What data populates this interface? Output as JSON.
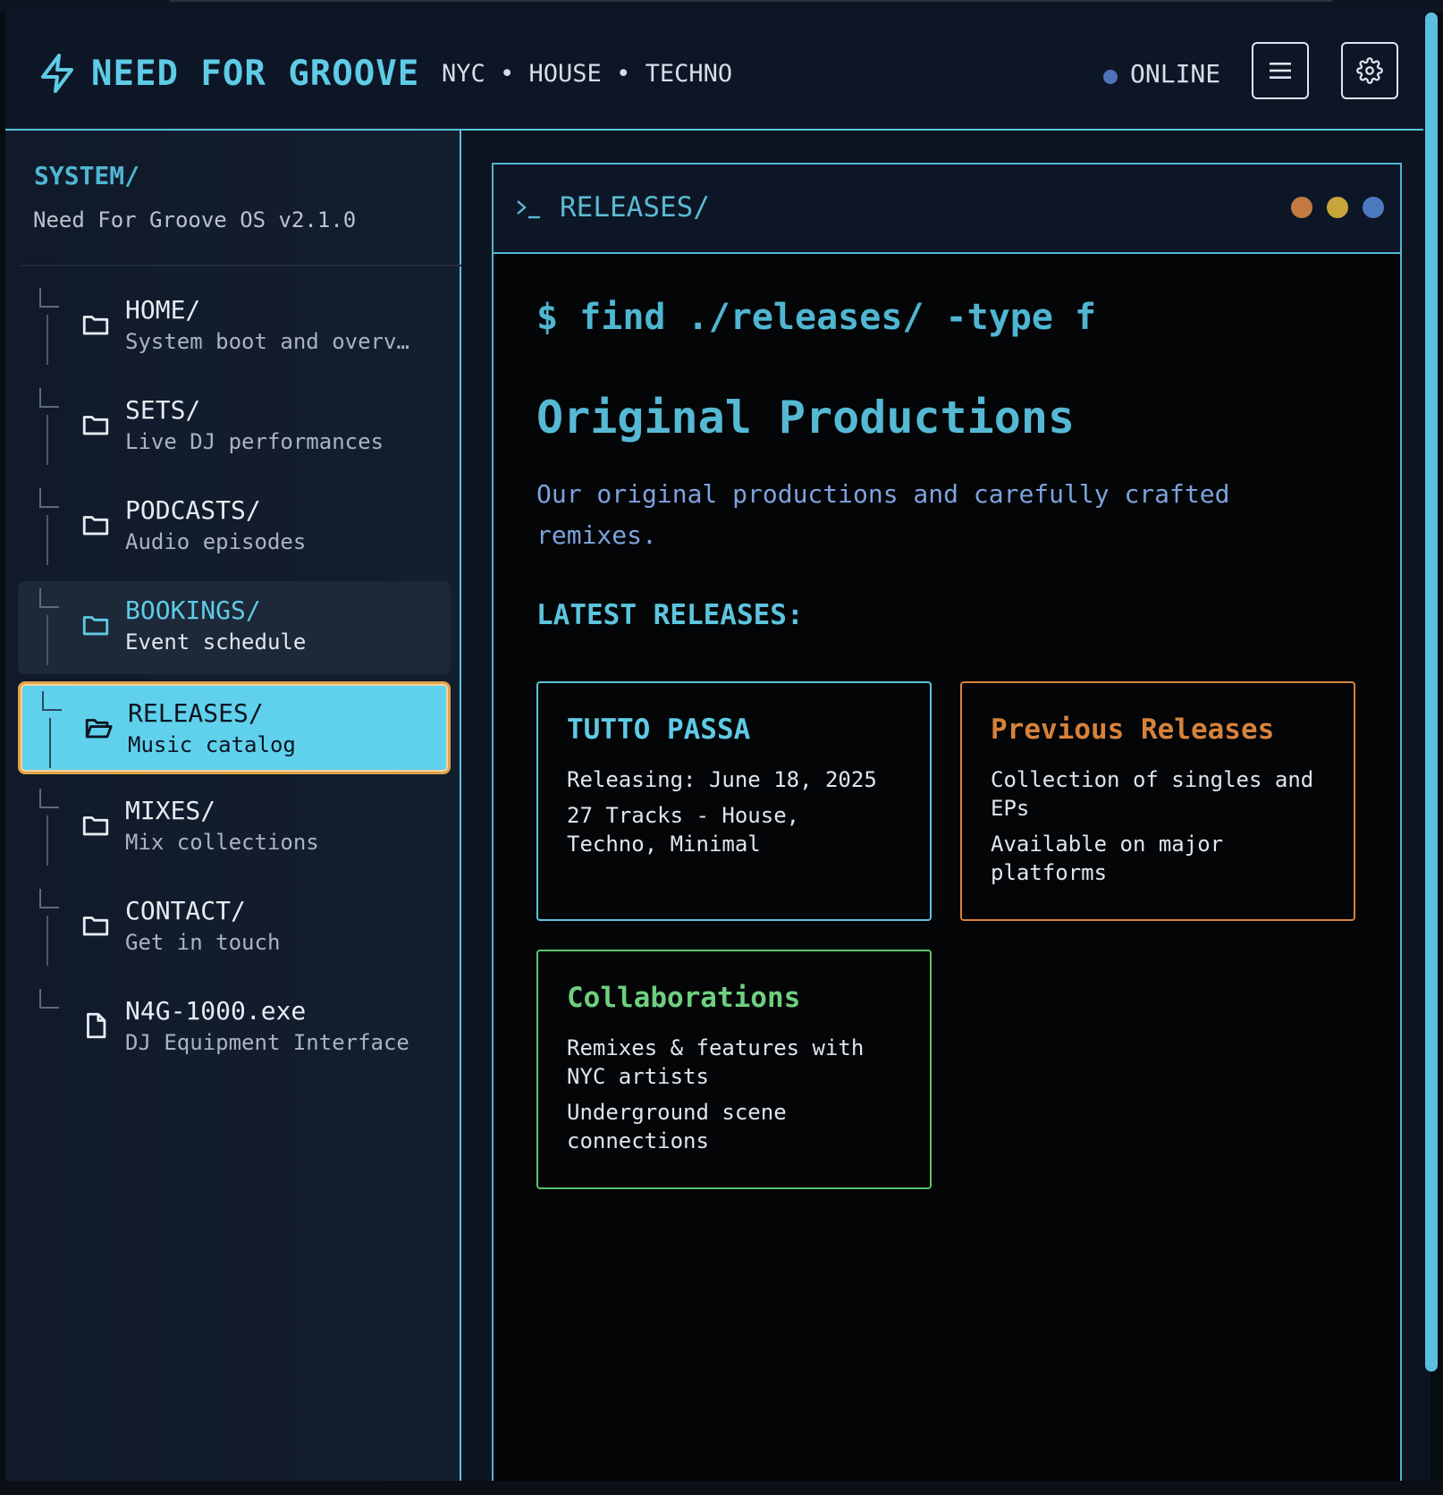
{
  "header": {
    "brand": "NEED FOR GROOVE",
    "tagline": "NYC • HOUSE • TECHNO",
    "status": "ONLINE",
    "status_color": "#5072b8",
    "menu_icon": "hamburger-icon",
    "settings_icon": "gear-icon",
    "logo_icon": "lightning-bolt-icon"
  },
  "sidebar": {
    "title": "SYSTEM/",
    "subtitle": "Need For Groove OS v2.1.0",
    "items": [
      {
        "label": "HOME/",
        "desc": "System boot and overview",
        "icon": "folder-icon",
        "state": "normal"
      },
      {
        "label": "SETS/",
        "desc": "Live DJ performances",
        "icon": "folder-icon",
        "state": "normal"
      },
      {
        "label": "PODCASTS/",
        "desc": "Audio episodes",
        "icon": "folder-icon",
        "state": "normal"
      },
      {
        "label": "BOOKINGS/",
        "desc": "Event schedule",
        "icon": "folder-icon",
        "state": "hover"
      },
      {
        "label": "RELEASES/",
        "desc": "Music catalog",
        "icon": "folder-open-icon",
        "state": "active"
      },
      {
        "label": "MIXES/",
        "desc": "Mix collections",
        "icon": "folder-icon",
        "state": "normal"
      },
      {
        "label": "CONTACT/",
        "desc": "Get in touch",
        "icon": "folder-icon",
        "state": "normal"
      },
      {
        "label": "N4G-1000.exe",
        "desc": "DJ Equipment Interface",
        "icon": "file-icon",
        "state": "normal"
      }
    ]
  },
  "terminal": {
    "title": "RELEASES/",
    "dots": [
      "#c27a42",
      "#c6a53a",
      "#4b79c0"
    ],
    "command": "$ find ./releases/ -type f",
    "section_title": "Original Productions",
    "intro": "Our original productions and carefully crafted remixes.",
    "latest_heading": "LATEST RELEASES:",
    "cards": [
      {
        "title": "TUTTO PASSA",
        "lines": [
          "Releasing: June 18, 2025",
          "27 Tracks - House, Techno, Minimal"
        ],
        "color": "#5cc4dd"
      },
      {
        "title": "Previous Releases",
        "lines": [
          "Collection of singles and EPs",
          "Available on major platforms"
        ],
        "color": "#d6823c"
      },
      {
        "title": "Collaborations",
        "lines": [
          "Remixes & features with NYC artists",
          "Underground scene connections"
        ],
        "color": "#5cc56a"
      }
    ]
  }
}
